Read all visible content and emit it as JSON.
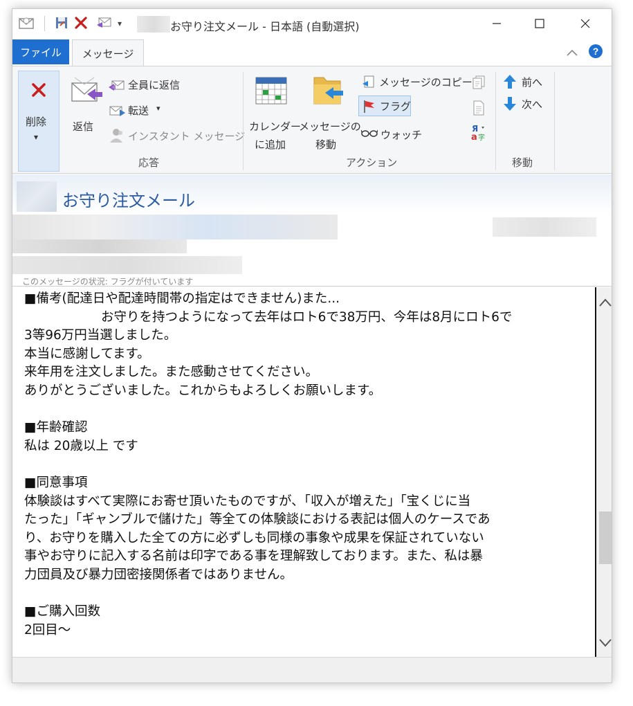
{
  "window": {
    "title": "お守り注文メール - 日本語 (自動選択)"
  },
  "tabs": {
    "file": "ファイル",
    "message": "メッセージ"
  },
  "ribbon": {
    "delete": {
      "label": "削除",
      "arrow": "▾"
    },
    "reply": {
      "label": "返信"
    },
    "reply_all": {
      "label": "全員に返信"
    },
    "forward": {
      "label": "転送",
      "arrow": "▾"
    },
    "instant_message": {
      "label": "インスタント メッセージ"
    },
    "group_respond": "応答",
    "add_calendar": {
      "line1": "カレンダー",
      "line2": "に追加"
    },
    "move_message": {
      "line1": "メッセージの",
      "line2": "移動"
    },
    "copy_message": "メッセージのコピー",
    "flag": "フラグ",
    "watch": "ウォッチ",
    "group_action": "アクション",
    "prev": "前へ",
    "next": "次へ",
    "group_move": "移動"
  },
  "header": {
    "subject": "お守り注文メール",
    "info_bar": "このメッセージの状況: フラグが付いています"
  },
  "body": {
    "lines": [
      "■備考(配達日や配達時間帯の指定はできません)また...",
      "　　　　　　お守りを持つようになって去年はロト6で38万円、今年は8月にロト6で",
      "3等96万円当選しました。",
      "本当に感謝してます。",
      "来年用を注文しました。また感動させてください。",
      "ありがとうございました。これからもよろしくお願いします。",
      "",
      "■年齢確認",
      "私は 20歳以上 です",
      "",
      "■同意事項",
      "体験談はすべて実際にお寄せ頂いたものですが、「収入が増えた」「宝くじに当",
      "たった」「ギャンブルで儲けた」等全ての体験談における表記は個人のケースであ",
      "り、お守りを購入した全ての方に必ずしも同様の事象や成果を保証されていない",
      "事やお守りに記入する名前は印字である事を理解致しております。また、私は暴",
      "力団員及び暴力団密接関係者ではありません。",
      "",
      "■ご購入回数",
      "2回目～"
    ]
  },
  "colors": {
    "file_tab": "#1e6fcf",
    "subject_text": "#2c5aa0",
    "ribbon_bg": "#f5f6f7",
    "selected_button": "#dde9f6"
  }
}
